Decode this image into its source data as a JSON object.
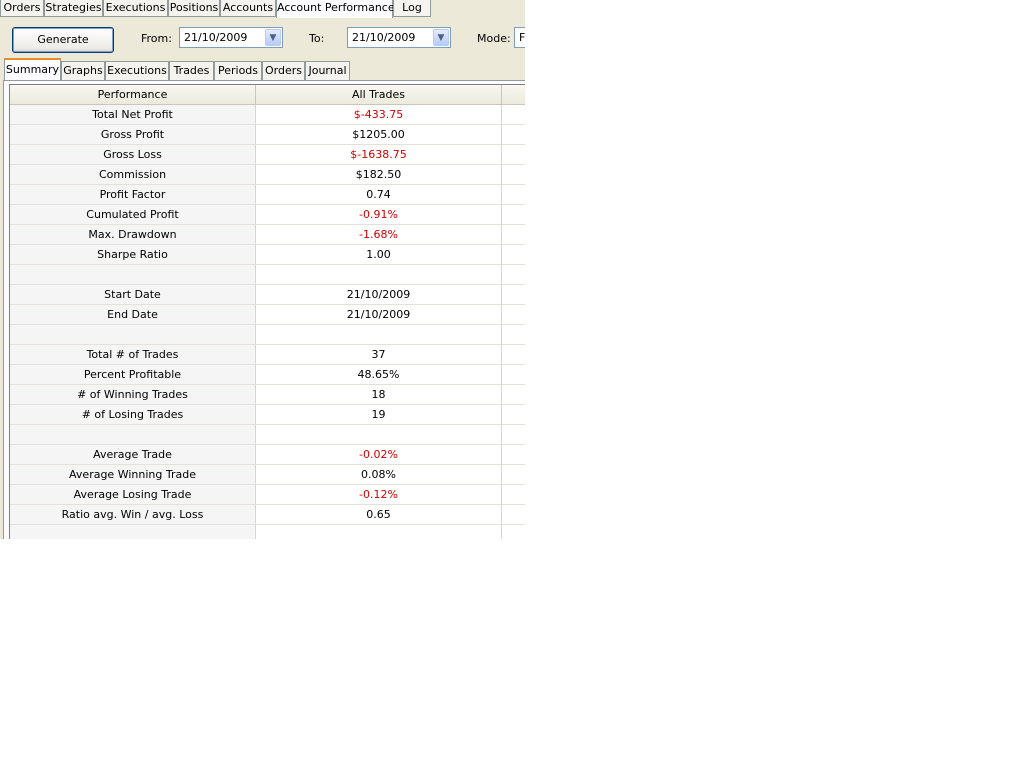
{
  "top_tabs": [
    {
      "label": "Orders"
    },
    {
      "label": "Strategies"
    },
    {
      "label": "Executions"
    },
    {
      "label": "Positions"
    },
    {
      "label": "Accounts"
    },
    {
      "label": "Account Performance",
      "active": true
    },
    {
      "label": "Log"
    }
  ],
  "toolbar": {
    "generate_label": "Generate",
    "from_label": "From:",
    "from_value": "21/10/2009",
    "to_label": "To:",
    "to_value": "21/10/2009",
    "mode_label": "Mode:",
    "mode_value": "F"
  },
  "sub_tabs": [
    {
      "label": "Summary",
      "active": true
    },
    {
      "label": "Graphs"
    },
    {
      "label": "Executions"
    },
    {
      "label": "Trades"
    },
    {
      "label": "Periods"
    },
    {
      "label": "Orders"
    },
    {
      "label": "Journal"
    }
  ],
  "grid": {
    "headers": [
      "Performance",
      "All Trades"
    ],
    "rows": [
      {
        "label": "Total Net Profit",
        "value": "$-433.75",
        "negative": true
      },
      {
        "label": "Gross Profit",
        "value": "$1205.00"
      },
      {
        "label": "Gross Loss",
        "value": "$-1638.75",
        "negative": true
      },
      {
        "label": "Commission",
        "value": "$182.50"
      },
      {
        "label": "Profit Factor",
        "value": "0.74"
      },
      {
        "label": "Cumulated Profit",
        "value": "-0.91%",
        "negative": true
      },
      {
        "label": "Max. Drawdown",
        "value": "-1.68%",
        "negative": true
      },
      {
        "label": "Sharpe Ratio",
        "value": "1.00"
      },
      {
        "label": "",
        "value": ""
      },
      {
        "label": "Start Date",
        "value": "21/10/2009"
      },
      {
        "label": "End Date",
        "value": "21/10/2009"
      },
      {
        "label": "",
        "value": ""
      },
      {
        "label": "Total # of Trades",
        "value": "37"
      },
      {
        "label": "Percent Profitable",
        "value": "48.65%"
      },
      {
        "label": "# of Winning Trades",
        "value": "18"
      },
      {
        "label": "# of Losing Trades",
        "value": "19"
      },
      {
        "label": "",
        "value": ""
      },
      {
        "label": "Average Trade",
        "value": "-0.02%",
        "negative": true
      },
      {
        "label": "Average Winning Trade",
        "value": "0.08%"
      },
      {
        "label": "Average Losing Trade",
        "value": "-0.12%",
        "negative": true
      },
      {
        "label": "Ratio avg. Win / avg. Loss",
        "value": "0.65"
      },
      {
        "label": "",
        "value": ""
      }
    ]
  },
  "colors": {
    "negative": "#cc0000",
    "active_tab_accent": "#e68b2c"
  }
}
